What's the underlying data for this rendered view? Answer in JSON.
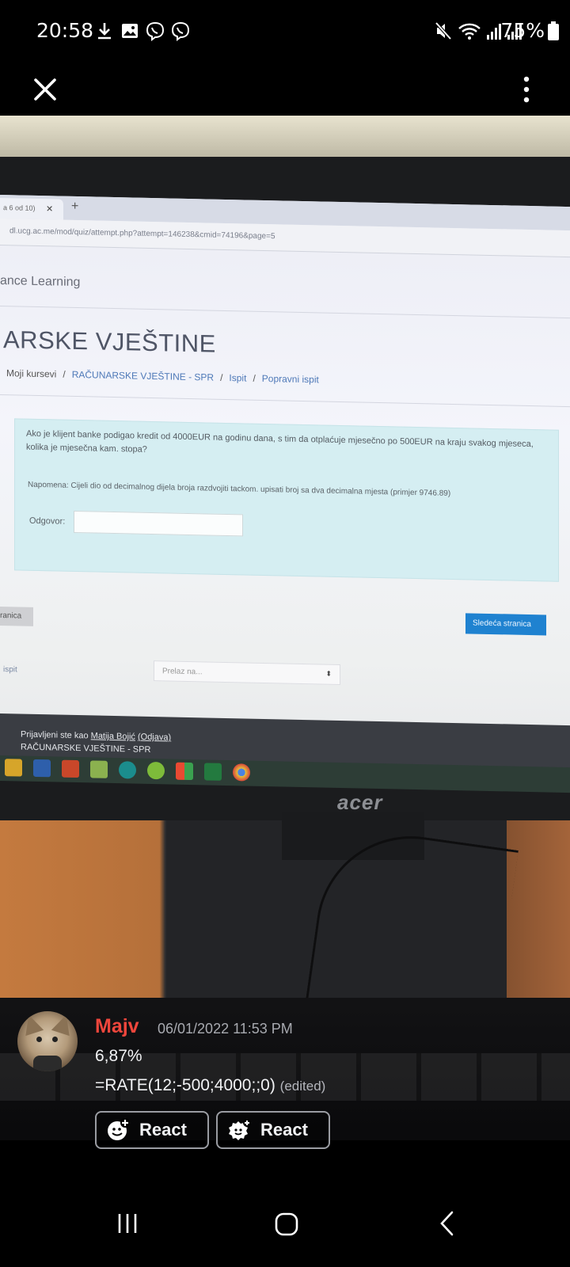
{
  "status_bar": {
    "time": "20:58",
    "battery": "75%",
    "left_icons": [
      "download-icon",
      "image-icon",
      "viber-icon",
      "viber-icon"
    ],
    "right_icons": [
      "mute-icon",
      "wifi-icon",
      "signal-icon",
      "signal-icon"
    ]
  },
  "viewer": {
    "close_icon": "close-icon",
    "menu_icon": "more-vert-icon"
  },
  "photo": {
    "browser_tab": "a 6 od 10)",
    "url": "dl.ucg.ac.me/mod/quiz/attempt.php?attempt=146238&cmid=74196&page=5",
    "site_title": "ance Learning",
    "course_title": "ARSKE VJEŠTINE",
    "breadcrumbs": [
      "Moji kursevi",
      "RAČUNARSKE VJEŠTINE - SPR",
      "Ispit",
      "Popravni ispit"
    ],
    "question": "Ako je klijent banke podigao kredit od 4000EUR na godinu dana, s tim da otplaćuje mjesečno po 500EUR na kraju svakog mjeseca, kolika je mjesečna kam. stopa?",
    "note": "Napomena: Cijeli dio od decimalnog dijela broja razdvojiti tackom. upisati broj sa dva decimalna mjesta (primjer 9746.89)",
    "answer_label": "Odgovor:",
    "answer_value": "",
    "prev_button": "ranica",
    "next_button": "Sledeća stranica",
    "ispit_link": "ispit",
    "jump_select": "Prelaz na...",
    "footer_login_prefix": "Prijavljeni ste kao ",
    "footer_user": "Matija Bojić",
    "footer_logout": "(Odjava)",
    "footer_course": "RAČUNARSKE VJEŠTINE - SPR",
    "monitor_brand": "acer"
  },
  "message": {
    "author": "Majv",
    "timestamp": "06/01/2022 11:53 PM",
    "line1": "6,87%",
    "line2": "=RATE(12;-500;4000;;0)",
    "edited": "(edited)",
    "author_color": "#f0463c"
  },
  "actions": {
    "react_1": "React",
    "react_2": "React"
  },
  "navigation": {
    "icons": [
      "recent-apps-icon",
      "home-icon",
      "back-icon"
    ]
  }
}
